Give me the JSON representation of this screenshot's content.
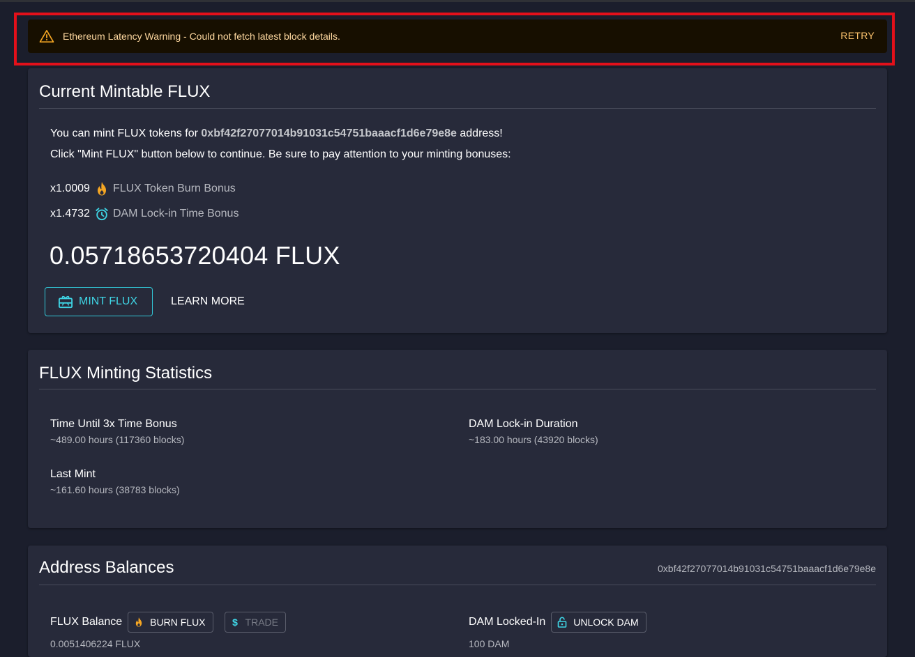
{
  "alert": {
    "message": "Ethereum Latency Warning - Could not fetch latest block details.",
    "retry_label": "RETRY"
  },
  "mintable": {
    "title": "Current Mintable FLUX",
    "line1_prefix": "You can mint FLUX tokens for ",
    "address": "0xbf42f27077014b91031c54751baaacf1d6e79e8e",
    "line1_suffix": " address!",
    "line2": "Click \"Mint FLUX\" button below to continue. Be sure to pay attention to your minting bonuses:",
    "bonuses": [
      {
        "multiplier": "x1.0009",
        "label": "FLUX Token Burn Bonus",
        "icon": "fire-icon"
      },
      {
        "multiplier": "x1.4732",
        "label": "DAM Lock-in Time Bonus",
        "icon": "alarm-clock-icon"
      }
    ],
    "amount": "0.05718653720404 FLUX",
    "mint_label": "MINT FLUX",
    "learn_label": "LEARN MORE"
  },
  "statistics": {
    "title": "FLUX Minting Statistics",
    "items": [
      {
        "label": "Time Until 3x Time Bonus",
        "value": "~489.00 hours (117360 blocks)"
      },
      {
        "label": "DAM Lock-in Duration",
        "value": "~183.00 hours (43920 blocks)"
      },
      {
        "label": "Last Mint",
        "value": "~161.60 hours (38783 blocks)"
      }
    ]
  },
  "balances": {
    "title": "Address Balances",
    "address": "0xbf42f27077014b91031c54751baaacf1d6e79e8e",
    "flux": {
      "label": "FLUX Balance",
      "value": "0.0051406224 FLUX",
      "burn_label": "BURN FLUX",
      "trade_label": "TRADE"
    },
    "dam": {
      "label": "DAM Locked-In",
      "value": "100 DAM",
      "unlock_label": "UNLOCK DAM"
    }
  },
  "colors": {
    "background": "#1b1e2c",
    "card": "#272a3a",
    "accent_cyan": "#3fd6e6",
    "warning_orange": "#f5a623",
    "highlight_border": "#e3101a"
  }
}
